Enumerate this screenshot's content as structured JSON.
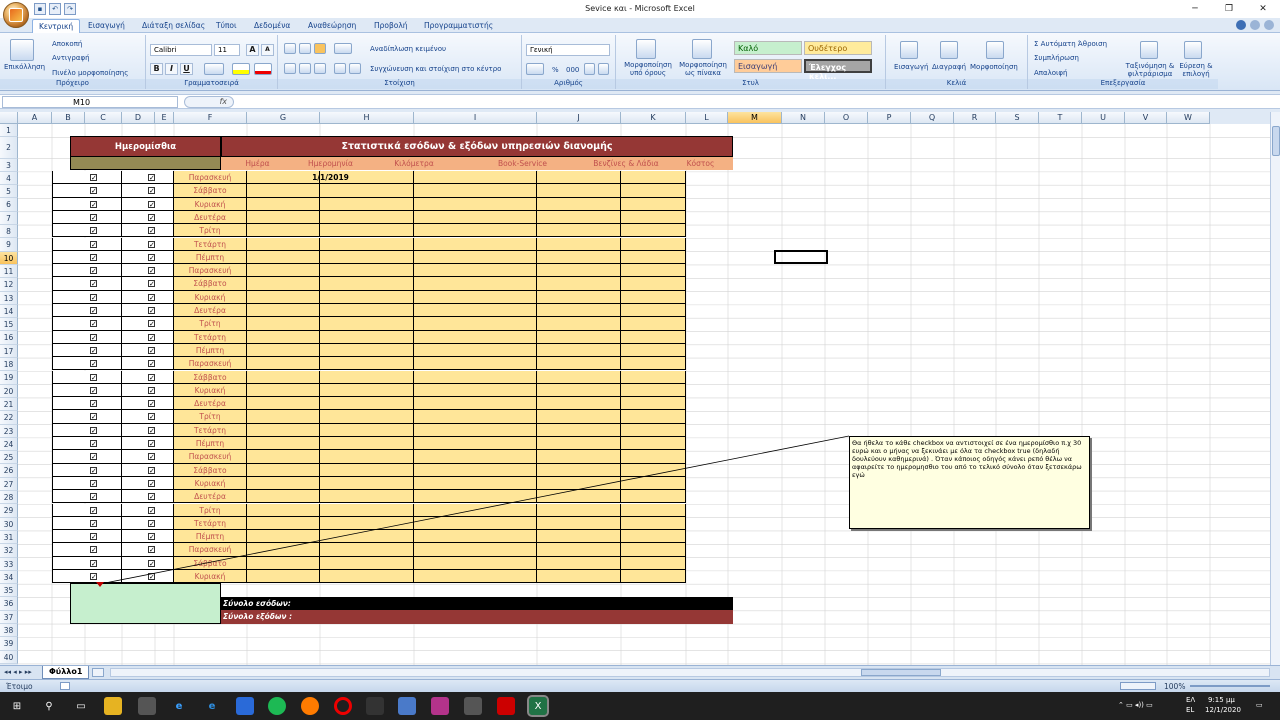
{
  "window": {
    "title": "Sevice και - Microsoft Excel"
  },
  "tabs": [
    "Κεντρική",
    "Εισαγωγή",
    "Διάταξη σελίδας",
    "Τύποι",
    "Δεδομένα",
    "Αναθεώρηση",
    "Προβολή",
    "Προγραμματιστής"
  ],
  "ribbon": {
    "clipboard": {
      "paste": "Επικόλληση",
      "cut": "Αποκοπή",
      "copy": "Αντιγραφή",
      "format_painter": "Πινέλο μορφοποίησης",
      "label": "Πρόχειρο"
    },
    "font": {
      "name": "Calibri",
      "size": "11",
      "bold": "B",
      "italic": "I",
      "underline": "U",
      "grow": "A",
      "shrink": "A",
      "label": "Γραμματοσειρά"
    },
    "alignment": {
      "wrap": "Αναδίπλωση κειμένου",
      "merge": "Συγχώνευση και στοίχιση στο κέντρο",
      "label": "Στοίχιση"
    },
    "number": {
      "format": "Γενική",
      "percent": "%",
      "thousands": "000",
      "label": "Αριθμός"
    },
    "styles": {
      "cond": "Μορφοποίηση υπό όρους",
      "table": "Μορφοποίηση ως πίνακα",
      "good": "Καλό",
      "neutral": "Ουδέτερο",
      "input": "Εισαγωγή",
      "check": "Έλεγχος κελι...",
      "label": "Στυλ"
    },
    "cells": {
      "insert": "Εισαγωγή",
      "delete": "Διαγραφή",
      "format": "Μορφοποίηση",
      "label": "Κελιά"
    },
    "editing": {
      "autosum": "Αυτόματη Άθροιση",
      "fill": "Συμπλήρωση",
      "clear": "Απαλοιφή",
      "sort": "Ταξινόμηση & φιλτράρισμα",
      "find": "Εύρεση & επιλογή",
      "label": "Επεξεργασία"
    }
  },
  "formula": {
    "namebox": "M10",
    "fx": "fx",
    "value": ""
  },
  "columns": [
    "A",
    "B",
    "C",
    "D",
    "E",
    "F",
    "G",
    "H",
    "I",
    "J",
    "K",
    "L",
    "M",
    "N",
    "O",
    "P",
    "Q",
    "R",
    "S",
    "T",
    "U",
    "V",
    "W"
  ],
  "selected_column": "M",
  "selected_row": 10,
  "rows": [
    1,
    2,
    3,
    4,
    5,
    6,
    7,
    8,
    9,
    10,
    11,
    12,
    13,
    14,
    15,
    16,
    17,
    18,
    19,
    20,
    21,
    22,
    23,
    24,
    25,
    26,
    27,
    28,
    29,
    30,
    31,
    32,
    33,
    34,
    35,
    36,
    37,
    38,
    39,
    40
  ],
  "sheet": {
    "wages_title": "Ημερομίσθια",
    "main_title": "Στατιστικά εσόδων & εξόδων υπηρεσιών διανομής",
    "headers": [
      "Ημέρα",
      "Ημερομηνία",
      "Κιλόμετρα",
      "Book-Service",
      "Βενζίνες & Λάδια",
      "Κόστος"
    ],
    "first_date": "1/1/2019",
    "days": [
      "Παρασκευή",
      "Σάββατο",
      "Κυριακή",
      "Δευτέρα",
      "Τρίτη",
      "Τετάρτη",
      "Πέμπτη",
      "Παρασκευή",
      "Σάββατο",
      "Κυριακή",
      "Δευτέρα",
      "Τρίτη",
      "Τετάρτη",
      "Πέμπτη",
      "Παρασκευή",
      "Σάββατο",
      "Κυριακή",
      "Δευτέρα",
      "Τρίτη",
      "Τετάρτη",
      "Πέμπτη",
      "Παρασκευή",
      "Σάββατο",
      "Κυριακή",
      "Δευτέρα",
      "Τρίτη",
      "Τετάρτη",
      "Πέμπτη",
      "Παρασκευή",
      "Σάββατο",
      "Κυριακή"
    ],
    "checkbox_mark": "✓",
    "total_income": "Σύνολο εσόδων:",
    "total_expenses": "Σύνολο εξόδων :"
  },
  "comment": "Θα ήθελα το κάθε checkbox να αντιστοιχεί σε ένα ημερομίσθιο π.χ 30 ευρώ και ο μήνας να ξεκινάει με όλα τα checkbox true (δηλαδή δουλεύουν καθημερινά) . Όταν κάποιος οδηγός κάνει ρεπό θέλω να αφαιρείτε το ημερομησθιο του από το τελικό σύνολο όταν ξετσεκάρω εγώ",
  "sheet_tab": "Φύλλο1",
  "status": {
    "ready": "Έτοιμο",
    "zoom": "100%"
  },
  "taskbar": {
    "lang_top": "ΕΛ",
    "lang_bottom": "EL",
    "time": "9:15 μμ",
    "date": "12/1/2020"
  },
  "colors": {
    "title_red": "#953735",
    "day_yellow": "#ffe699",
    "green": "#c6efce",
    "dark_row": "#000000"
  }
}
